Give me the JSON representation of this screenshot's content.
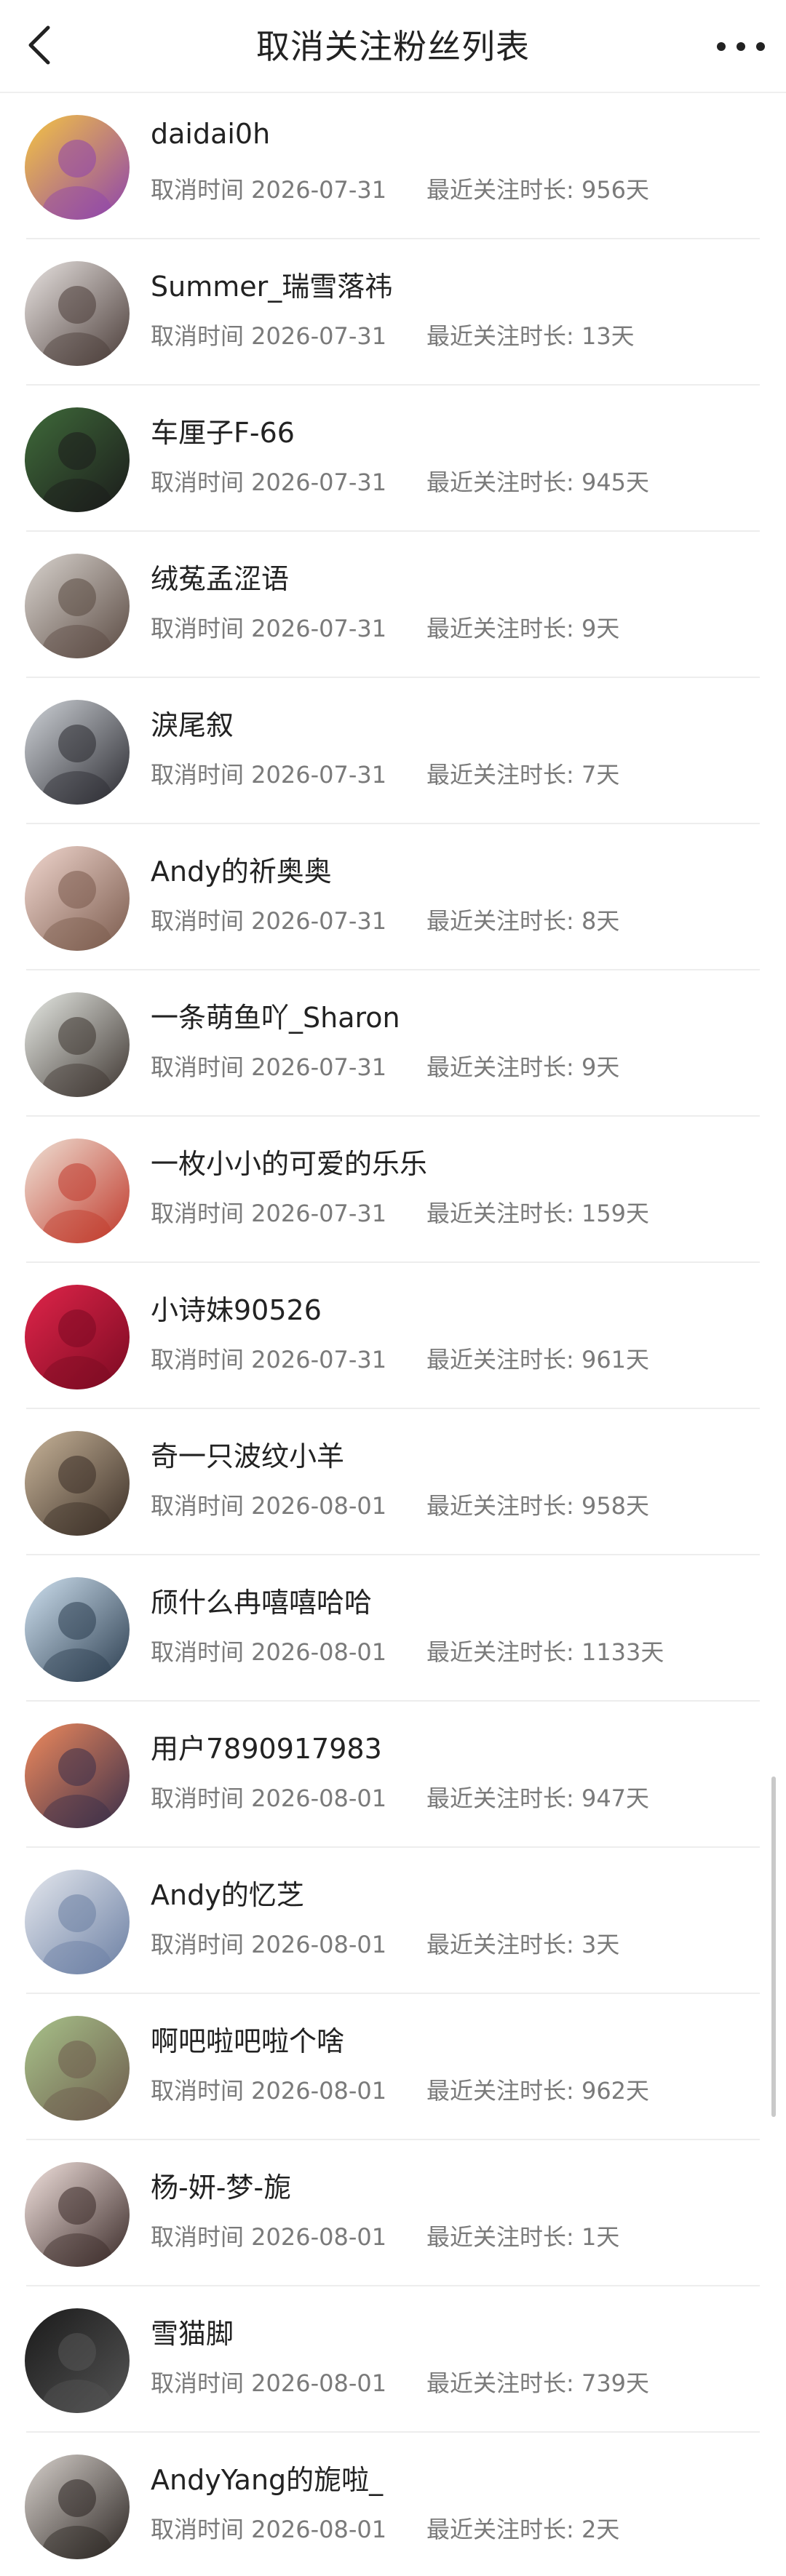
{
  "header": {
    "title": "取消关注粉丝列表",
    "back_icon": "chevron-left-icon",
    "more_icon": "more-horizontal-icon"
  },
  "labels": {
    "cancel_prefix": "取消时间",
    "duration_prefix": "最近关注时长:",
    "day_suffix": "天"
  },
  "users": [
    {
      "name": "daidai0h",
      "cancel_text": "取消时间 2026-07-31",
      "duration_text": "最近关注时长: 956天",
      "avatar_colors": [
        "#f5c542",
        "#8e44ad"
      ]
    },
    {
      "name": "Summer_瑞雪落祎",
      "cancel_text": "取消时间 2026-07-31",
      "duration_text": "最近关注时长: 13天",
      "avatar_colors": [
        "#e9e4e2",
        "#4a3c38"
      ]
    },
    {
      "name": "车厘子F-66",
      "cancel_text": "取消时间 2026-07-31",
      "duration_text": "最近关注时长: 945天",
      "avatar_colors": [
        "#3f6b3a",
        "#1b1b1b"
      ]
    },
    {
      "name": "绒菟孟涩语",
      "cancel_text": "取消时间 2026-07-31",
      "duration_text": "最近关注时长: 9天",
      "avatar_colors": [
        "#d9d4cf",
        "#5a4a42"
      ]
    },
    {
      "name": "淚尾叙",
      "cancel_text": "取消时间 2026-07-31",
      "duration_text": "最近关注时长: 7天",
      "avatar_colors": [
        "#cfd3d8",
        "#2a2a30"
      ]
    },
    {
      "name": "Andy的祈奥奥",
      "cancel_text": "取消时间 2026-07-31",
      "duration_text": "最近关注时长: 8天",
      "avatar_colors": [
        "#f1d7cf",
        "#7a5a4c"
      ]
    },
    {
      "name": "一条萌鱼吖_Sharon",
      "cancel_text": "取消时间 2026-07-31",
      "duration_text": "最近关注时长: 9天",
      "avatar_colors": [
        "#e8ebe6",
        "#3d3530"
      ]
    },
    {
      "name": "一枚小小的可爱的乐乐",
      "cancel_text": "取消时间 2026-07-31",
      "duration_text": "最近关注时长: 159天",
      "avatar_colors": [
        "#efe2d6",
        "#c0392b"
      ]
    },
    {
      "name": "小诗妹90526",
      "cancel_text": "取消时间 2026-07-31",
      "duration_text": "最近关注时长: 961天",
      "avatar_colors": [
        "#e0254a",
        "#7b0a22"
      ]
    },
    {
      "name": "奇一只波纹小羊",
      "cancel_text": "取消时间 2026-08-01",
      "duration_text": "最近关注时长: 958天",
      "avatar_colors": [
        "#c9b59a",
        "#3a2e26"
      ]
    },
    {
      "name": "颀什么冉嘻嘻哈哈",
      "cancel_text": "取消时间 2026-08-01",
      "duration_text": "最近关注时长: 1133天",
      "avatar_colors": [
        "#cfe1f0",
        "#2c3e50"
      ]
    },
    {
      "name": "用户7890917983",
      "cancel_text": "取消时间 2026-08-01",
      "duration_text": "最近关注时长: 947天",
      "avatar_colors": [
        "#f08a5d",
        "#3a2f4a"
      ]
    },
    {
      "name": "Andy的忆芝",
      "cancel_text": "取消时间 2026-08-01",
      "duration_text": "最近关注时长: 3天",
      "avatar_colors": [
        "#e5e8ee",
        "#6b7fa3"
      ]
    },
    {
      "name": "啊吧啦吧啦个啥",
      "cancel_text": "取消时间 2026-08-01",
      "duration_text": "最近关注时长: 962天",
      "avatar_colors": [
        "#a8c38a",
        "#6d5b4d"
      ]
    },
    {
      "name": "杨-妍-梦-旎",
      "cancel_text": "取消时间 2026-08-01",
      "duration_text": "最近关注时长: 1天",
      "avatar_colors": [
        "#f3e3df",
        "#3a2a28"
      ]
    },
    {
      "name": "雪猫脚",
      "cancel_text": "取消时间 2026-08-01",
      "duration_text": "最近关注时长: 739天",
      "avatar_colors": [
        "#1a1a1a",
        "#555555"
      ]
    },
    {
      "name": "AndyYang的旎啦_",
      "cancel_text": "取消时间 2026-08-01",
      "duration_text": "最近关注时长: 2天",
      "avatar_colors": [
        "#d8d2cd",
        "#2b2522"
      ]
    }
  ]
}
